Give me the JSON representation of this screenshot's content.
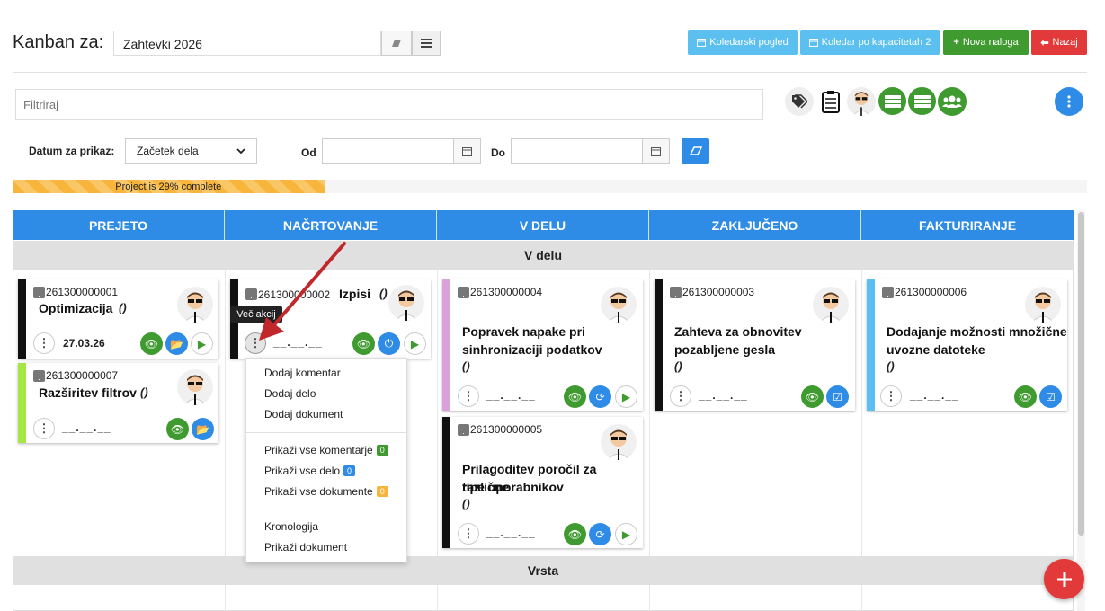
{
  "header": {
    "title": "Kanban za:",
    "board_value": "Zahtevki 2026",
    "buttons": {
      "calendar": "Koledarski pogled",
      "capacity": "Koledar po kapacitetah 2",
      "new": "Nova naloga",
      "back": "Nazaj"
    }
  },
  "filter": {
    "placeholder": "Filtriraj"
  },
  "date_filter": {
    "label": "Datum za prikaz:",
    "selected": "Začetek dela",
    "from_label": "Od",
    "to_label": "Do"
  },
  "progress": {
    "label": "Project is 29% complete",
    "percent": 29
  },
  "columns": [
    "PREJETO",
    "NAČRTOVANJE",
    "V DELU",
    "ZAKLJUČENO",
    "FAKTURIRANJE"
  ],
  "swimlanes": {
    "first": "V delu",
    "second": "Vrsta"
  },
  "cards": {
    "c1": {
      "code": "261300000001",
      "title": "Optimizacija",
      "sub": "()",
      "date": "27.03.26"
    },
    "c7": {
      "code": "261300000007",
      "title": "Razširitev filtrov",
      "sub": "()",
      "date": "__.__.__"
    },
    "c2": {
      "code": "261300000002",
      "title": "Izpisi",
      "sub": "()",
      "date": "__.__.__"
    },
    "c4": {
      "code": "261300000004",
      "title1": "Popravek napake pri",
      "title2": "sinhronizaciji podatkov",
      "sub": "()",
      "date": "__.__.__"
    },
    "c5": {
      "code": "261300000005",
      "title1": "Prilagoditev poročil za različne",
      "title2": "tipe uporabnikov",
      "sub": "()",
      "date": "__.__.__"
    },
    "c3": {
      "code": "261300000003",
      "title1": "Zahteva za obnovitev",
      "title2": "pozabljene gesla",
      "sub": "()",
      "date": "__.__.__"
    },
    "c6": {
      "code": "261300000006",
      "title1": "Dodajanje možnosti množične",
      "title2": "uvozne datoteke",
      "sub": "()",
      "date": "__.__.__"
    }
  },
  "tooltip": "Več akcij",
  "menu": {
    "add_comment": "Dodaj komentar",
    "add_work": "Dodaj delo",
    "add_document": "Dodaj dokument",
    "show_comments": "Prikaži vse komentarje",
    "show_comments_count": "0",
    "show_work": "Prikaži vse delo",
    "show_work_count": "0",
    "show_documents": "Prikaži vse dokumente",
    "show_documents_count": "0",
    "chronology": "Kronologija",
    "show_document": "Prikaži dokument"
  },
  "colors": {
    "blue": "#2e8be6",
    "light_blue": "#5bc0ef",
    "green": "#3f9a2f",
    "red": "#e23a3a",
    "orange": "#f7b53b",
    "lime": "#a6e645",
    "pink": "#d9a2dd"
  }
}
